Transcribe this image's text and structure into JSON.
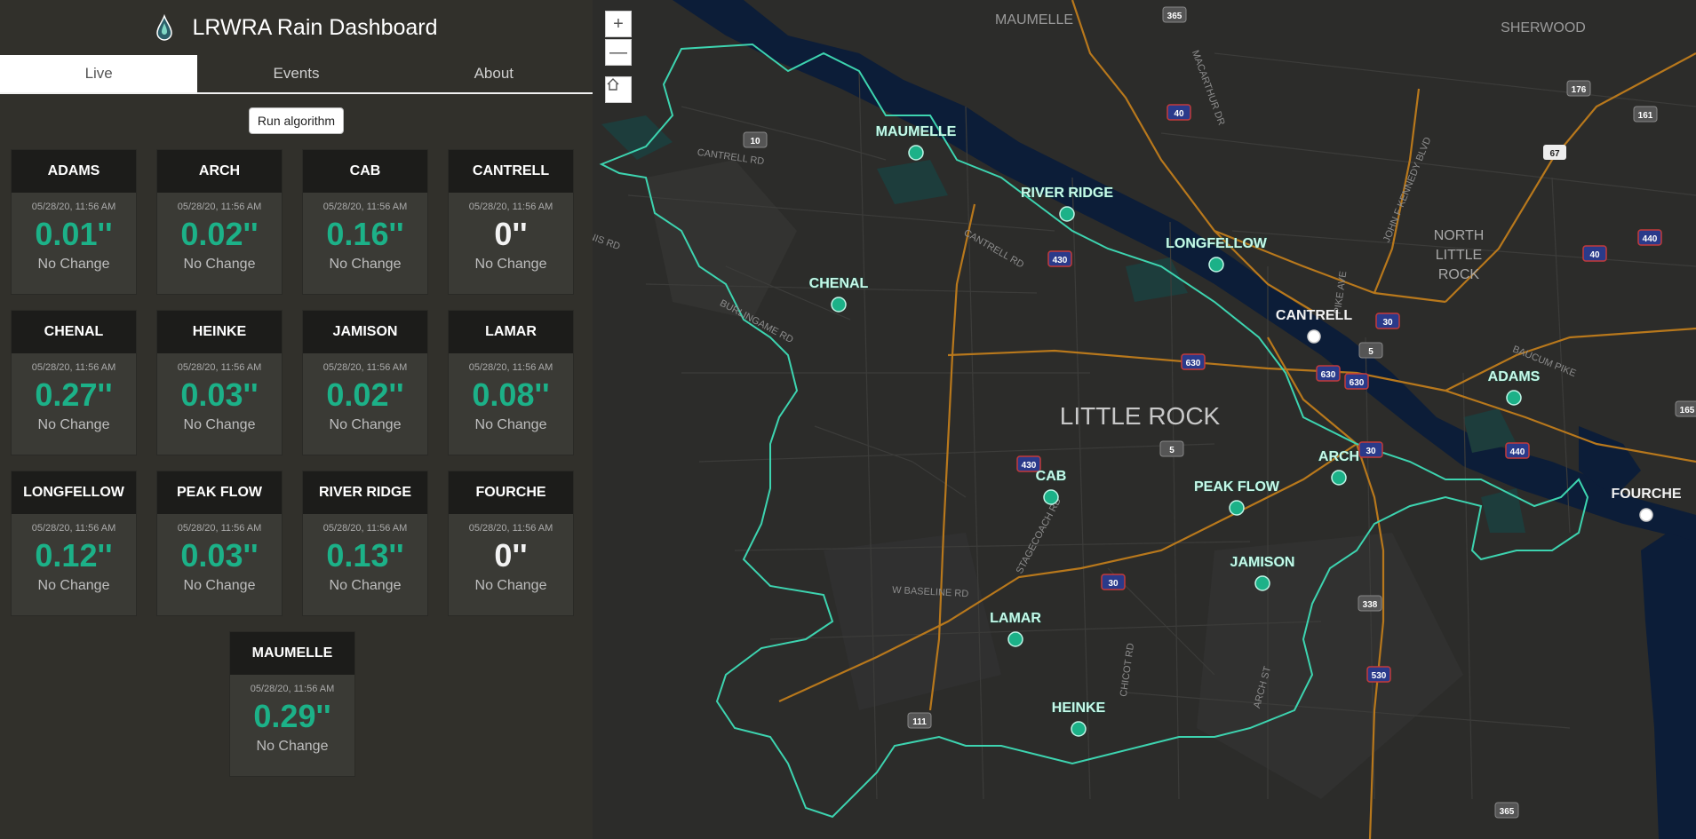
{
  "header": {
    "title": "LRWRA Rain Dashboard",
    "logo_icon": "water-drop-icon"
  },
  "tabs": [
    {
      "label": "Live",
      "active": true
    },
    {
      "label": "Events",
      "active": false
    },
    {
      "label": "About",
      "active": false
    }
  ],
  "run_button": "Run algorithm",
  "stations": [
    {
      "name": "ADAMS",
      "timestamp": "05/28/20, 11:56 AM",
      "value": "0.01''",
      "change": "No Change",
      "color": "#1cb188"
    },
    {
      "name": "ARCH",
      "timestamp": "05/28/20, 11:56 AM",
      "value": "0.02''",
      "change": "No Change",
      "color": "#1cb188"
    },
    {
      "name": "CAB",
      "timestamp": "05/28/20, 11:56 AM",
      "value": "0.16''",
      "change": "No Change",
      "color": "#1cb188"
    },
    {
      "name": "CANTRELL",
      "timestamp": "05/28/20, 11:56 AM",
      "value": "0''",
      "change": "No Change",
      "color": "#f2f2f2"
    },
    {
      "name": "CHENAL",
      "timestamp": "05/28/20, 11:56 AM",
      "value": "0.27''",
      "change": "No Change",
      "color": "#1cb188"
    },
    {
      "name": "HEINKE",
      "timestamp": "05/28/20, 11:56 AM",
      "value": "0.03''",
      "change": "No Change",
      "color": "#1cb188"
    },
    {
      "name": "JAMISON",
      "timestamp": "05/28/20, 11:56 AM",
      "value": "0.02''",
      "change": "No Change",
      "color": "#1cb188"
    },
    {
      "name": "LAMAR",
      "timestamp": "05/28/20, 11:56 AM",
      "value": "0.08''",
      "change": "No Change",
      "color": "#1cb188"
    },
    {
      "name": "LONGFELLOW",
      "timestamp": "05/28/20, 11:56 AM",
      "value": "0.12''",
      "change": "No Change",
      "color": "#1cb188"
    },
    {
      "name": "PEAK FLOW",
      "timestamp": "05/28/20, 11:56 AM",
      "value": "0.03''",
      "change": "No Change",
      "color": "#1cb188"
    },
    {
      "name": "RIVER RIDGE",
      "timestamp": "05/28/20, 11:56 AM",
      "value": "0.13''",
      "change": "No Change",
      "color": "#1cb188"
    },
    {
      "name": "FOURCHE",
      "timestamp": "05/28/20, 11:56 AM",
      "value": "0''",
      "change": "No Change",
      "color": "#f2f2f2"
    },
    {
      "name": "MAUMELLE",
      "timestamp": "05/28/20, 11:56 AM",
      "value": "0.29''",
      "change": "No Change",
      "color": "#1cb188"
    }
  ],
  "map": {
    "controls": {
      "zoom_in": "+",
      "zoom_out": "—",
      "home_icon": "home-icon"
    },
    "places": [
      "MAUMELLE",
      "SHERWOOD",
      "NORTH",
      "LITTLE",
      "ROCK",
      "LITTLE ROCK"
    ],
    "roads": [
      "CANTRELL RD",
      "CANTRELL RD",
      "BURLINGAME RD",
      "STAGECOACH RD",
      "W BASELINE RD",
      "CHICOT RD",
      "ARCH ST",
      "JOHN F KENNEDY BLVD",
      "MACARTHUR DR",
      "BAUCUM PIKE",
      "PIKE AVE",
      "NIS RD"
    ],
    "shields": [
      "365",
      "40",
      "176",
      "161",
      "67",
      "440",
      "40",
      "430",
      "10",
      "30",
      "5",
      "630",
      "630",
      "630",
      "30",
      "440",
      "430",
      "5",
      "30",
      "338",
      "530",
      "111",
      "365",
      "165"
    ],
    "station_labels": [
      "MAUMELLE",
      "RIVER RIDGE",
      "LONGFELLOW",
      "CHENAL",
      "CANTRELL",
      "ADAMS",
      "ARCH",
      "PEAK FLOW",
      "CAB",
      "FOURCHE",
      "JAMISON",
      "LAMAR",
      "HEINKE"
    ],
    "colors": {
      "accent": "#1cb188",
      "boundary": "#3dd4b0",
      "water": "#0c1d38",
      "land": "#2c2c2a",
      "highway": "#c8821f",
      "marker_inactive": "#ffffff"
    }
  }
}
